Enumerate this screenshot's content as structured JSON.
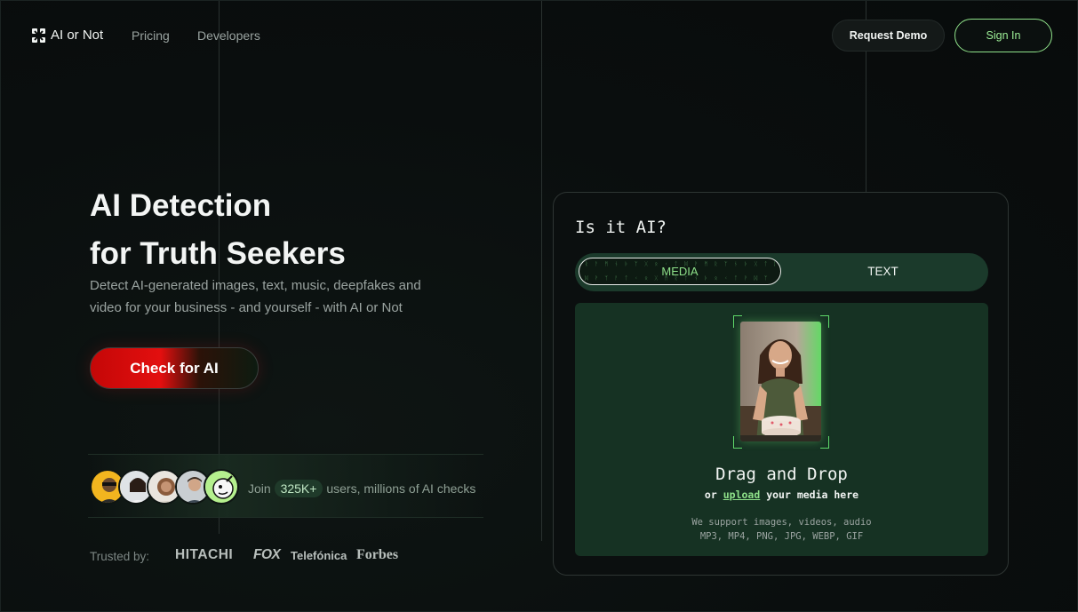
{
  "header": {
    "logo_text": "AI or Not",
    "nav": [
      {
        "label": "Pricing"
      },
      {
        "label": "Developers"
      }
    ],
    "request_demo_label": "Request Demo",
    "sign_in_label": "Sign In"
  },
  "hero": {
    "title_line1": "AI Detection",
    "title_line2": "for Truth Seekers",
    "subtitle_line1": "Detect AI-generated images, text, music, deepfakes and",
    "subtitle_line2": "video for your business - and yourself - with AI or Not",
    "cta_label": "Check for AI"
  },
  "social": {
    "prefix": "Join",
    "count": "325K+",
    "suffix": "users, millions of AI checks"
  },
  "trusted": {
    "label": "Trusted by:",
    "brands": [
      "HITACHI",
      "FOX",
      "Telefónica",
      "Forbes"
    ]
  },
  "card": {
    "title": "Is it AI?",
    "tab_media": "MEDIA",
    "tab_text": "TEXT",
    "code_row1": "ᚱ ᚨ ᛗ ᚾ ᚦ ᛉ ᚷ ᛟ ᚲ ᛏ ᛞ ᚹ ᛗ ᚱ ᛉ ᚾ ᚦ ᚷ ᛏ ᛞ ᛟ ᚲ ᚹ ᛗ ᚱ",
    "code_row2": "ᛞ ᚹ ᛉ ᚨ ᛏ ᚲ ᛟ ᚷ ᛗ ᚱ ᛉ ᚾ ᚦ ᛟ ᚲ ᛏ ᚹ ᛞ ᛉ ᚨ ᛗ ᚱ ᚷ ᛟ ᚲ",
    "drop_title": "Drag and Drop",
    "drop_or": "or",
    "drop_link": "upload",
    "drop_rest": "your media here",
    "support_line1": "We support images, videos, audio",
    "support_line2": "MP3, MP4, PNG, JPG, WEBP, GIF"
  },
  "colors": {
    "accent": "#8fe28a",
    "cta_red": "#e30f0f",
    "panel_green": "#163223",
    "background": "#0a0e0e"
  }
}
